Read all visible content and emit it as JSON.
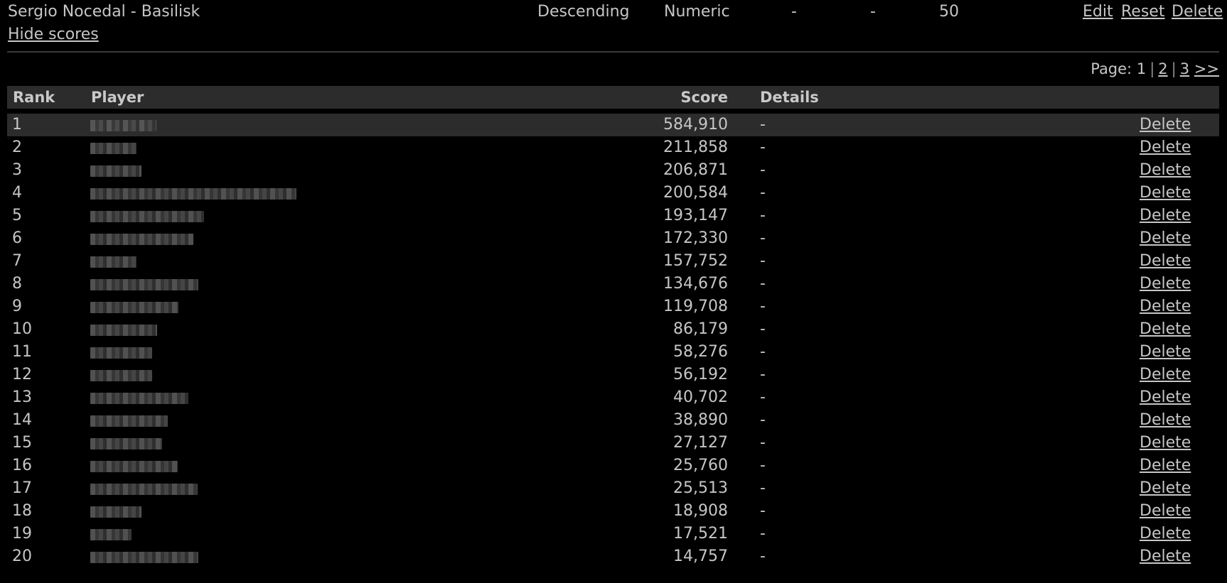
{
  "leaderboard": {
    "name": "Sergio Nocedal - Basilisk",
    "order": "Descending",
    "type": "Numeric",
    "col_a": "-",
    "col_b": "-",
    "limit": "50",
    "edit": "Edit",
    "reset": "Reset",
    "delete": "Delete"
  },
  "hide_scores": "Hide scores",
  "pager": {
    "label": "Page:",
    "current": "1",
    "sep": "|",
    "page2": "2",
    "page3": "3",
    "next": ">>"
  },
  "table": {
    "headers": {
      "rank": "Rank",
      "player": "Player",
      "score": "Score",
      "details": "Details"
    },
    "rows": [
      {
        "rank": "1",
        "score": "584,910",
        "details": "-",
        "action": "Delete",
        "player_blur_width": 93
      },
      {
        "rank": "2",
        "score": "211,858",
        "details": "-",
        "action": "Delete",
        "player_blur_width": 65
      },
      {
        "rank": "3",
        "score": "206,871",
        "details": "-",
        "action": "Delete",
        "player_blur_width": 72
      },
      {
        "rank": "4",
        "score": "200,584",
        "details": "-",
        "action": "Delete",
        "player_blur_width": 290
      },
      {
        "rank": "5",
        "score": "193,147",
        "details": "-",
        "action": "Delete",
        "player_blur_width": 160
      },
      {
        "rank": "6",
        "score": "172,330",
        "details": "-",
        "action": "Delete",
        "player_blur_width": 145
      },
      {
        "rank": "7",
        "score": "157,752",
        "details": "-",
        "action": "Delete",
        "player_blur_width": 65
      },
      {
        "rank": "8",
        "score": "134,676",
        "details": "-",
        "action": "Delete",
        "player_blur_width": 152
      },
      {
        "rank": "9",
        "score": "119,708",
        "details": "-",
        "action": "Delete",
        "player_blur_width": 124
      },
      {
        "rank": "10",
        "score": "86,179",
        "details": "-",
        "action": "Delete",
        "player_blur_width": 94
      },
      {
        "rank": "11",
        "score": "58,276",
        "details": "-",
        "action": "Delete",
        "player_blur_width": 87
      },
      {
        "rank": "12",
        "score": "56,192",
        "details": "-",
        "action": "Delete",
        "player_blur_width": 87
      },
      {
        "rank": "13",
        "score": "40,702",
        "details": "-",
        "action": "Delete",
        "player_blur_width": 138
      },
      {
        "rank": "14",
        "score": "38,890",
        "details": "-",
        "action": "Delete",
        "player_blur_width": 109
      },
      {
        "rank": "15",
        "score": "27,127",
        "details": "-",
        "action": "Delete",
        "player_blur_width": 101
      },
      {
        "rank": "16",
        "score": "25,760",
        "details": "-",
        "action": "Delete",
        "player_blur_width": 123
      },
      {
        "rank": "17",
        "score": "25,513",
        "details": "-",
        "action": "Delete",
        "player_blur_width": 151
      },
      {
        "rank": "18",
        "score": "18,908",
        "details": "-",
        "action": "Delete",
        "player_blur_width": 72
      },
      {
        "rank": "19",
        "score": "17,521",
        "details": "-",
        "action": "Delete",
        "player_blur_width": 58
      },
      {
        "rank": "20",
        "score": "14,757",
        "details": "-",
        "action": "Delete",
        "player_blur_width": 152
      }
    ]
  }
}
